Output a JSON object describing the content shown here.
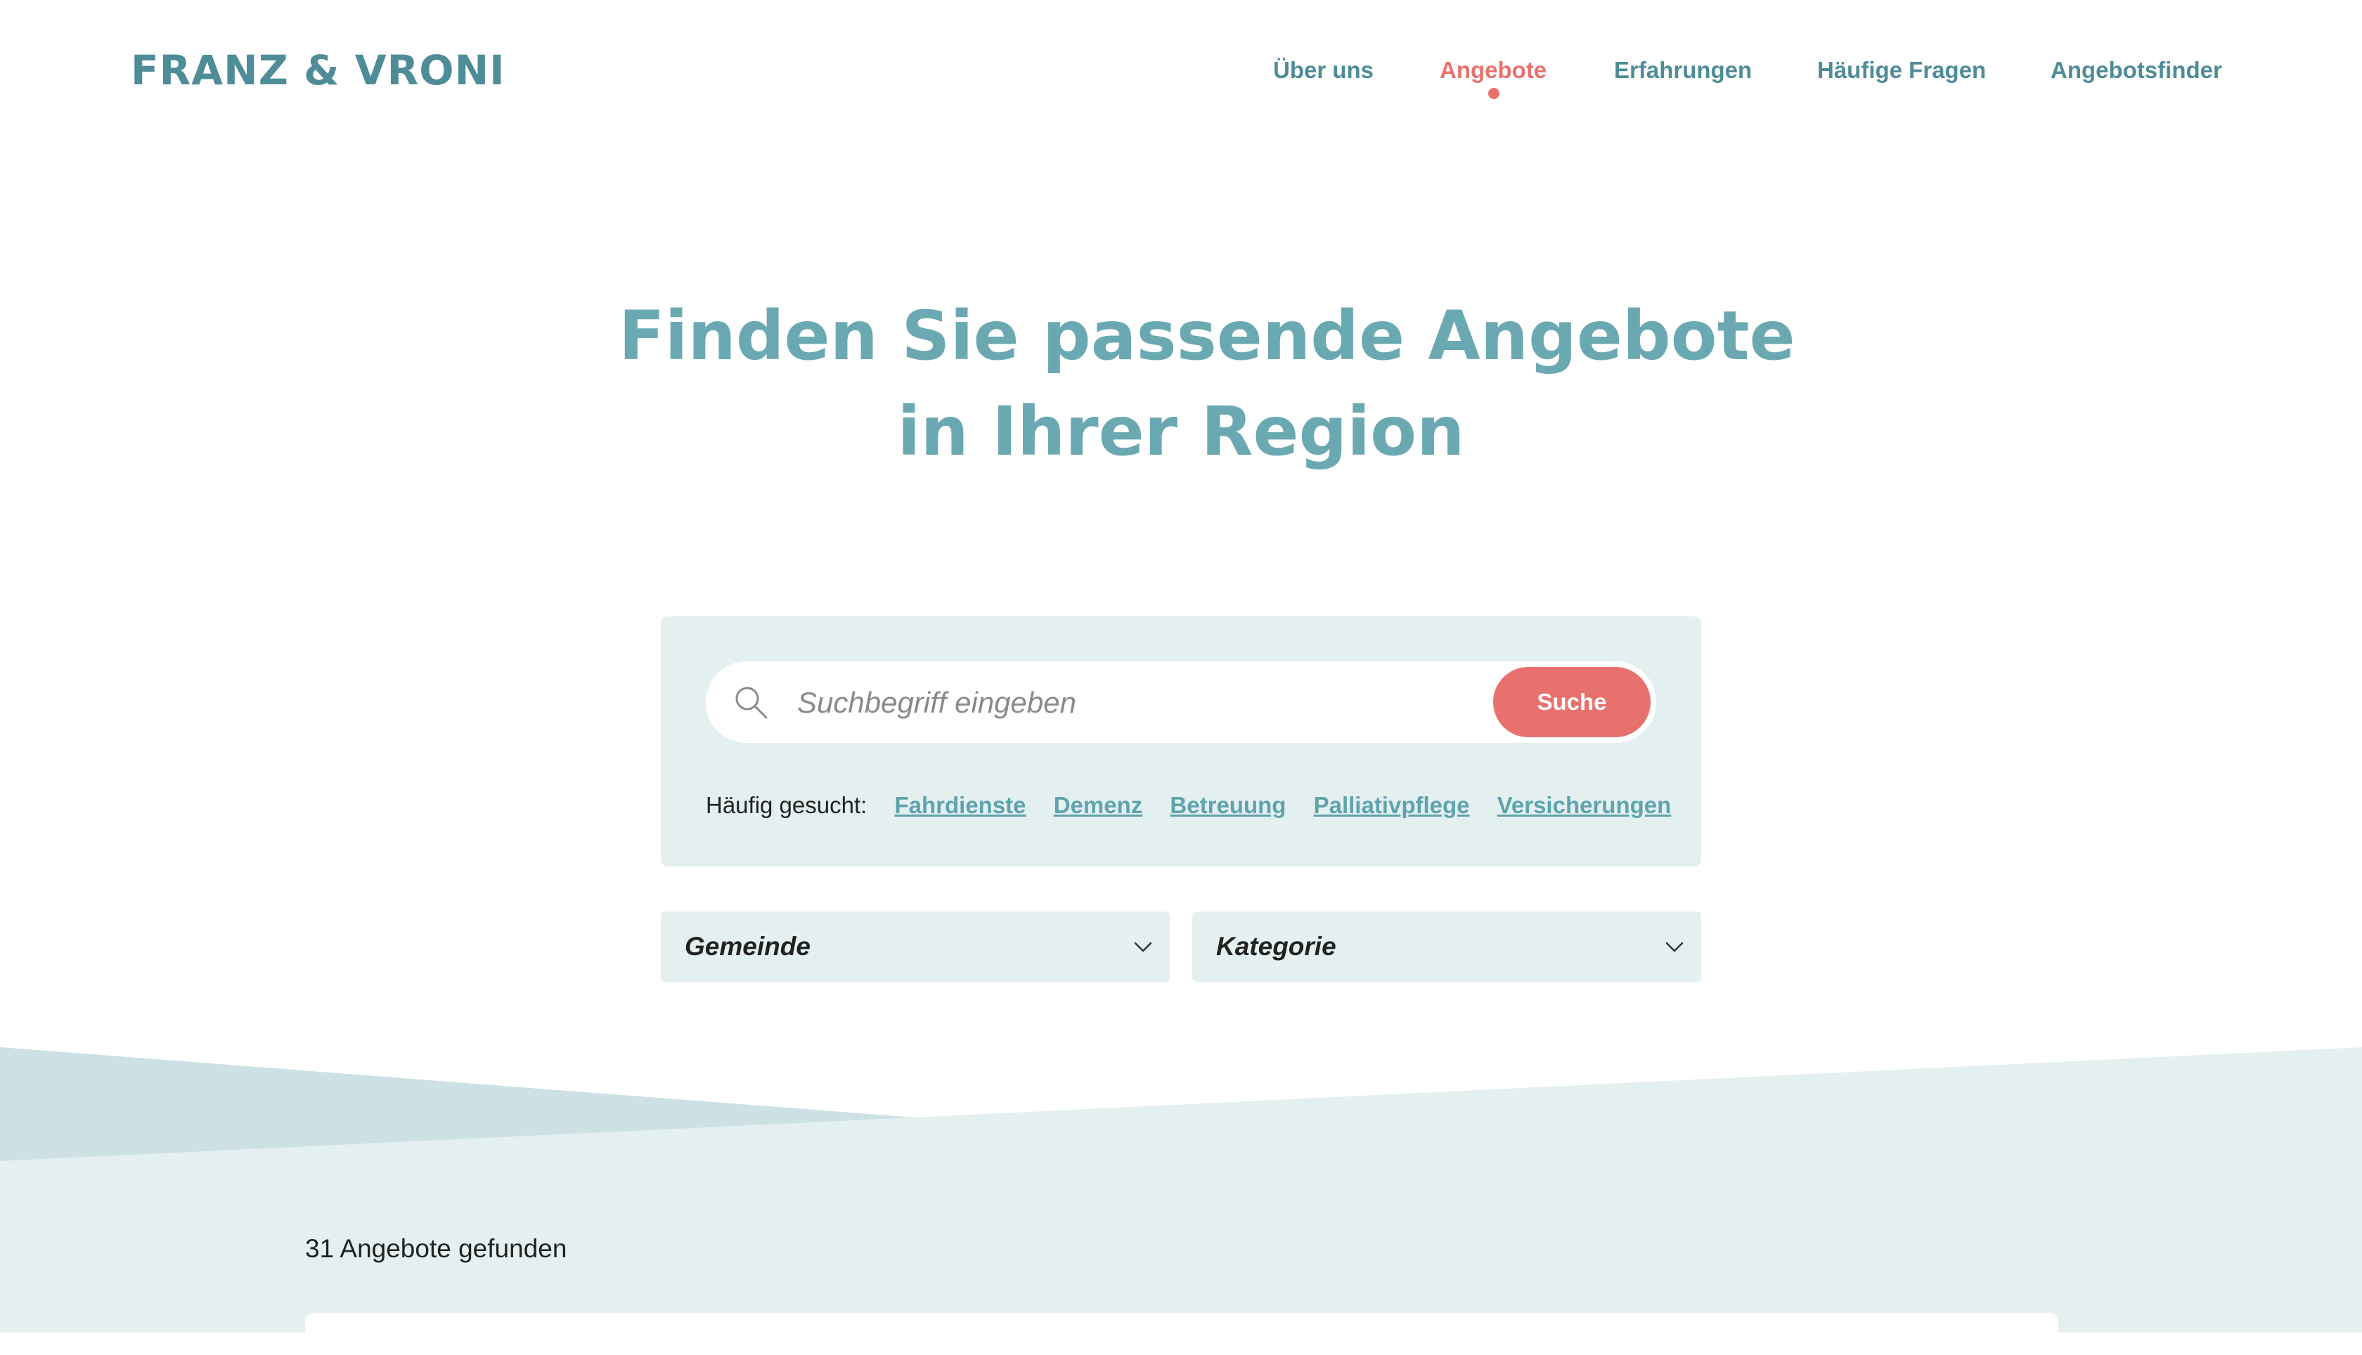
{
  "header": {
    "logo": "FRANZ & VRONI",
    "nav": [
      {
        "label": "Über uns",
        "active": false
      },
      {
        "label": "Angebote",
        "active": true
      },
      {
        "label": "Erfahrungen",
        "active": false
      },
      {
        "label": "Häufige Fragen",
        "active": false
      },
      {
        "label": "Angebotsfinder",
        "active": false
      }
    ]
  },
  "hero": {
    "title_line1": "Finden Sie passende Angebote",
    "title_line2": "in Ihrer Region"
  },
  "search": {
    "placeholder": "Suchbegriff eingeben",
    "value": "",
    "button_label": "Suche",
    "frequent_label": "Häufig gesucht:",
    "frequent_links": [
      "Fahrdienste",
      "Demenz",
      "Betreuung",
      "Palliativpflege",
      "Versicherungen"
    ]
  },
  "filters": {
    "gemeinde": "Gemeinde",
    "kategorie": "Kategorie"
  },
  "results": {
    "count_text": "31 Angebote gefunden"
  },
  "colors": {
    "brand_teal": "#4e8c98",
    "title_teal": "#6ba9b2",
    "accent_coral": "#e8716d",
    "panel_bg": "#e4f0f0",
    "band_dark": "#cde1e4"
  },
  "icons": {
    "search": "search-icon",
    "dropdown": "chevron-down-icon",
    "active_indicator": "dot-indicator"
  }
}
